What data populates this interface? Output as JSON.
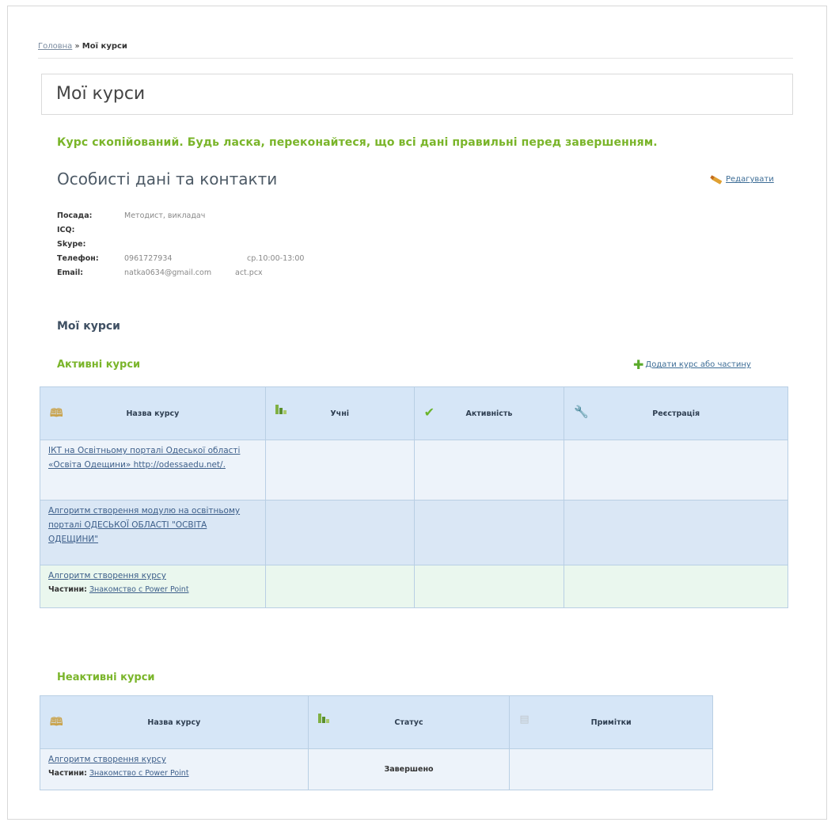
{
  "breadcrumb": {
    "home": "Головна",
    "separator": "»",
    "current": "Мої курси"
  },
  "page_title": "Мої курси",
  "notice": "Курс скопійований. Будь ласка, переконайтеся, що всі дані правильні перед завершенням.",
  "personal": {
    "heading": "Особисті дані та контакти",
    "edit_label": "Редагувати",
    "fields": [
      {
        "label": "Посада:",
        "value": "Методист, викладач",
        "extra": ""
      },
      {
        "label": "ICQ:",
        "value": "",
        "extra": ""
      },
      {
        "label": "Skype:",
        "value": "",
        "extra": ""
      },
      {
        "label": "Телефон:",
        "value": "0961727934",
        "extra": "ср.10:00-13:00"
      },
      {
        "label": "Email:",
        "value": "natka0634@gmail.com",
        "extra": "act.pcx"
      }
    ]
  },
  "my_courses_heading": "Мої курси",
  "active": {
    "heading": "Активні курси",
    "add_label": "Додати курс або частину",
    "columns": [
      "Назва курсу",
      "Учні",
      "Активність",
      "Реєстрація"
    ],
    "rows": [
      {
        "title": "ІКТ на Освітньому порталі Одеської області «Освіта Одещини» http://odessaedu.net/.",
        "part_label": "",
        "part_title": ""
      },
      {
        "title": "Алгоритм створення модулю на освітньому порталі ОДЕСЬКОЇ ОБЛАСТІ \"ОСВІТА ОДЕЩИНИ\"",
        "part_label": "",
        "part_title": ""
      },
      {
        "title": "Алгоритм створення курсу",
        "part_label": "Частини:",
        "part_title": "Знакомство с Power Point"
      }
    ]
  },
  "inactive": {
    "heading": "Неактивні курси",
    "columns": [
      "Назва курсу",
      "Статус",
      "Примітки"
    ],
    "rows": [
      {
        "title": "Алгоритм створення курсу",
        "part_label": "Частини:",
        "part_title": "Знакомство с Power Point",
        "status": "Завершено",
        "notes": ""
      }
    ]
  },
  "icons": {
    "course": "book-icon",
    "students": "chart-icon",
    "activity": "check-icon",
    "registration": "wrench-icon",
    "notes": "note-icon",
    "edit": "pencil-icon",
    "add": "plus-icon"
  },
  "colors": {
    "accent_green": "#7ab52a",
    "header_blue": "#d6e6f7",
    "link": "#3d6d96"
  }
}
